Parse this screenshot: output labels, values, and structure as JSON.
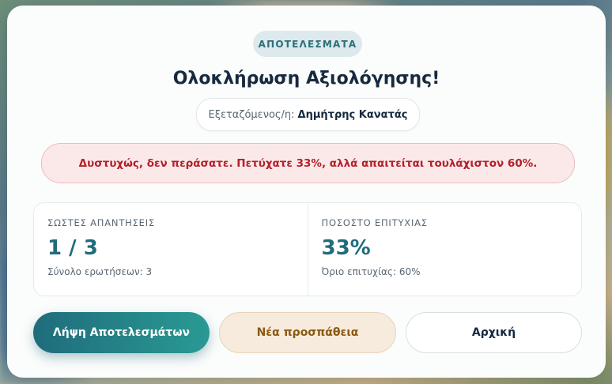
{
  "badge": "ΑΠΟΤΕΛΕΣΜΑΤΑ",
  "title": "Ολοκλήρωση Αξιολόγησης!",
  "examinee": {
    "label": "Εξεταζόμενος/η:",
    "name": "Δημήτρης Κανατάς"
  },
  "alert": {
    "text": "Δυστυχώς, δεν περάσατε. Πετύχατε 33%, αλλά απαιτείται τουλάχιστον 60%."
  },
  "stats": {
    "correct": {
      "label": "ΣΩΣΤΕΣ ΑΠΑΝΤΗΣΕΙΣ",
      "value": "1 / 3",
      "sub": "Σύνολο ερωτήσεων: 3"
    },
    "success": {
      "label": "ΠΟΣΟΣΤΟ ΕΠΙΤΥΧΙΑΣ",
      "value": "33%",
      "sub": "Όριο επιτυχίας: 60%"
    }
  },
  "buttons": {
    "download": "Λήψη Αποτελεσμάτων",
    "retry": "Νέα προσπάθεια",
    "home": "Αρχική"
  },
  "colors": {
    "accent": "#1f6c7c",
    "error": "#b3202a",
    "warning": "#8a5a12"
  }
}
